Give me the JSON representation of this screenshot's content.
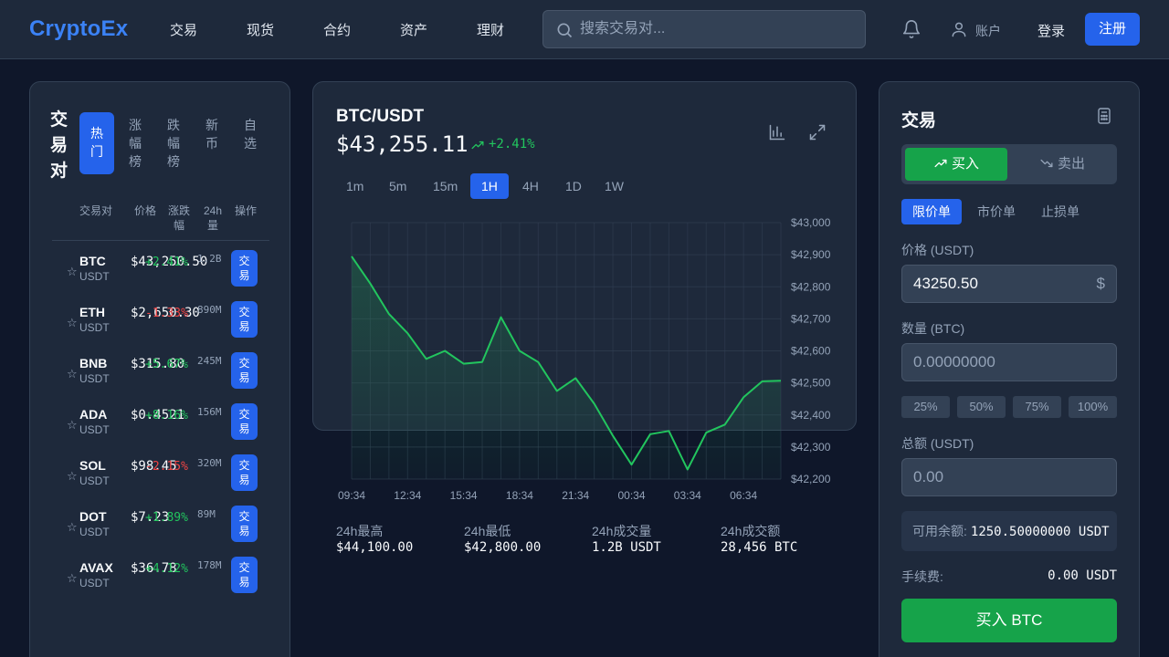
{
  "header": {
    "logo": "CryptoEx",
    "nav": [
      "交易",
      "现货",
      "合约",
      "资产",
      "理财"
    ],
    "search_placeholder": "搜索交易对...",
    "account_label": "账户",
    "login_label": "登录",
    "register_label": "注册"
  },
  "markets": {
    "title": "交易对",
    "tabs": [
      "热门",
      "涨幅榜",
      "跌幅榜",
      "新币",
      "自选"
    ],
    "columns": [
      "交易对",
      "价格",
      "涨跌幅",
      "24h量",
      "操作"
    ],
    "trade_label": "交易",
    "rows": [
      {
        "symbol": "BTC",
        "quote": "USDT",
        "price": "$43,250.50",
        "change": "+2.41%",
        "volume": "1.2B",
        "direction": "up"
      },
      {
        "symbol": "ETH",
        "quote": "USDT",
        "price": "$2,650.30",
        "change": "-1.33%",
        "volume": "890M",
        "direction": "down"
      },
      {
        "symbol": "BNB",
        "quote": "USDT",
        "price": "$315.80",
        "change": "+5.67%",
        "volume": "245M",
        "direction": "up"
      },
      {
        "symbol": "ADA",
        "quote": "USDT",
        "price": "$0.4521",
        "change": "+8.16%",
        "volume": "156M",
        "direction": "up"
      },
      {
        "symbol": "SOL",
        "quote": "USDT",
        "price": "$98.45",
        "change": "-2.15%",
        "volume": "320M",
        "direction": "down"
      },
      {
        "symbol": "DOT",
        "quote": "USDT",
        "price": "$7.23",
        "change": "+1.89%",
        "volume": "89M",
        "direction": "up"
      },
      {
        "symbol": "AVAX",
        "quote": "USDT",
        "price": "$36.78",
        "change": "+4.12%",
        "volume": "178M",
        "direction": "up"
      }
    ]
  },
  "chart_panel": {
    "pair": "BTC/USDT",
    "price": "$43,255.11",
    "change": "+2.41%",
    "timeframes": [
      "1m",
      "5m",
      "15m",
      "1H",
      "4H",
      "1D",
      "1W"
    ],
    "active_timeframe": "1H",
    "stats": [
      {
        "label": "24h最高",
        "value": "$44,100.00"
      },
      {
        "label": "24h最低",
        "value": "$42,800.00"
      },
      {
        "label": "24h成交量",
        "value": "1.2B USDT"
      },
      {
        "label": "24h成交额",
        "value": "28,456 BTC"
      }
    ]
  },
  "chart_data": {
    "type": "area",
    "x": [
      "09:34",
      "10:34",
      "11:34",
      "12:34",
      "13:34",
      "14:34",
      "15:34",
      "16:34",
      "17:34",
      "18:34",
      "19:34",
      "20:34",
      "21:34",
      "22:34",
      "23:34",
      "00:34",
      "01:34",
      "02:34",
      "03:34",
      "04:34",
      "05:34",
      "06:34",
      "07:34",
      "08:34"
    ],
    "xticks": [
      "09:34",
      "12:34",
      "15:34",
      "18:34",
      "21:34",
      "00:34",
      "03:34",
      "06:34"
    ],
    "values": [
      42895,
      42810,
      42715,
      42655,
      42575,
      42600,
      42560,
      42565,
      42705,
      42600,
      42565,
      42475,
      42515,
      42435,
      42335,
      42245,
      42340,
      42350,
      42230,
      42345,
      42370,
      42455,
      42505,
      42507
    ],
    "yticks": [
      "$43,000",
      "$42,900",
      "$42,800",
      "$42,700",
      "$42,600",
      "$42,500",
      "$42,400",
      "$42,300",
      "$42,200"
    ],
    "ylim": [
      42200,
      43000
    ],
    "color": "#22c55e",
    "grid": true
  },
  "trade": {
    "title": "交易",
    "buy_label": "买入",
    "sell_label": "卖出",
    "order_types": [
      "限价单",
      "市价单",
      "止损单"
    ],
    "active_order_type": "限价单",
    "price_label": "价格 (USDT)",
    "price_value": "43250.50",
    "price_suffix": "$",
    "amount_label": "数量 (BTC)",
    "amount_placeholder": "0.00000000",
    "percents": [
      "25%",
      "50%",
      "75%",
      "100%"
    ],
    "total_label": "总额 (USDT)",
    "total_placeholder": "0.00",
    "balance_label": "可用余额:",
    "balance_value": "1250.50000000 USDT",
    "fee_label": "手续费:",
    "fee_value": "0.00 USDT",
    "submit_label": "买入 BTC"
  }
}
